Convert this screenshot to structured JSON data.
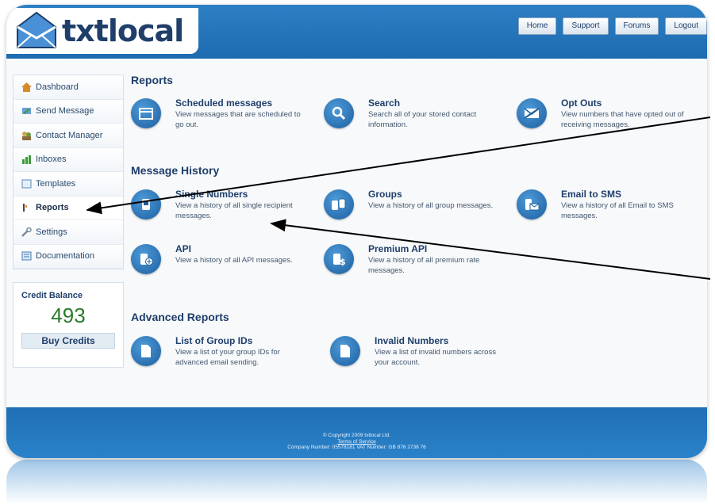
{
  "header": {
    "logo_text": "txtlocal",
    "nav": [
      "Home",
      "Support",
      "Forums",
      "Logout"
    ]
  },
  "sidebar": {
    "items": [
      {
        "label": "Dashboard",
        "icon": "house-icon"
      },
      {
        "label": "Send Message",
        "icon": "send-message-icon"
      },
      {
        "label": "Contact Manager",
        "icon": "contacts-icon"
      },
      {
        "label": "Inboxes",
        "icon": "inbox-chart-icon"
      },
      {
        "label": "Templates",
        "icon": "templates-icon"
      },
      {
        "label": "Reports",
        "icon": "reports-icon"
      },
      {
        "label": "Settings",
        "icon": "wrench-icon"
      },
      {
        "label": "Documentation",
        "icon": "documentation-icon"
      }
    ],
    "active": "Reports"
  },
  "credit": {
    "title": "Credit Balance",
    "value": "493",
    "buy_label": "Buy Credits"
  },
  "sections": {
    "reports": {
      "title": "Reports",
      "tiles": [
        {
          "title": "Scheduled messages",
          "desc": "View messages that are scheduled to go out.",
          "icon": "calendar-icon"
        },
        {
          "title": "Search",
          "desc": "Search all of your stored contact information.",
          "icon": "magnifier-icon"
        },
        {
          "title": "Opt Outs",
          "desc": "View numbers that have opted out of receiving messages.",
          "icon": "opt-out-icon"
        }
      ]
    },
    "history": {
      "title": "Message History",
      "tiles": [
        {
          "title": "Single Numbers",
          "desc": "View a history of all single recipient messages.",
          "icon": "single-number-icon"
        },
        {
          "title": "Groups",
          "desc": "View a history of all group messages.",
          "icon": "groups-icon"
        },
        {
          "title": "Email to SMS",
          "desc": "View a history of all Email to SMS messages.",
          "icon": "email-to-sms-icon"
        },
        {
          "title": "API",
          "desc": "View a history of all API messages.",
          "icon": "api-icon"
        },
        {
          "title": "Premium API",
          "desc": "View a history of all premium rate messages.",
          "icon": "premium-api-icon"
        }
      ]
    },
    "advanced": {
      "title": "Advanced Reports",
      "tiles": [
        {
          "title": "List of Group IDs",
          "desc": "View a list of your group IDs for advanced email sending.",
          "icon": "document-icon"
        },
        {
          "title": "Invalid Numbers",
          "desc": "View a list of invalid numbers across your account.",
          "icon": "document-icon"
        }
      ]
    }
  },
  "footer": {
    "copyright": "© Copyright 2009 txtlocal Ltd.",
    "terms": "Terms of Service",
    "company": "Company Number: 05578181  VAT Number: GB 876 2738 76"
  },
  "colors": {
    "brand_blue": "#1d6bb0",
    "heading_navy": "#1f3e6a",
    "credit_green": "#2a7a2a"
  }
}
